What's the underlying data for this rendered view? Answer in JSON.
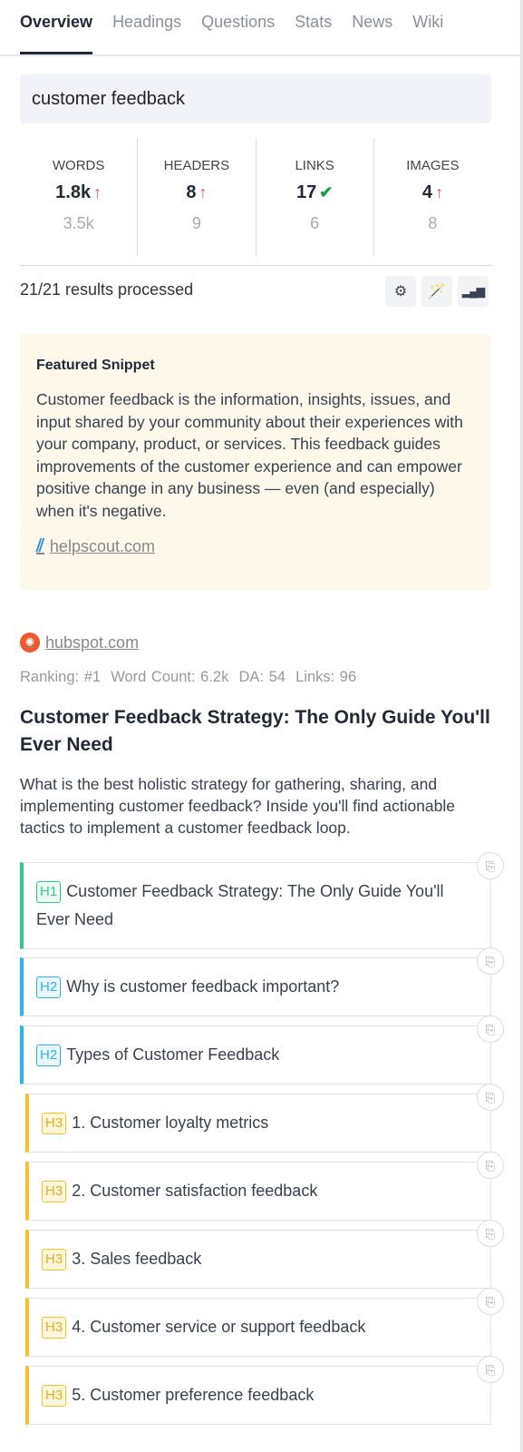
{
  "tabs": [
    "Overview",
    "Headings",
    "Questions",
    "Stats",
    "News",
    "Wiki"
  ],
  "keyword": "customer feedback",
  "stats": [
    {
      "label": "WORDS",
      "value": "1.8k",
      "icon": "arrow-up",
      "color": "#e05a5a",
      "compare": "3.5k"
    },
    {
      "label": "HEADERS",
      "value": "8",
      "icon": "arrow-up",
      "color": "#e05a5a",
      "compare": "9"
    },
    {
      "label": "LINKS",
      "value": "17",
      "icon": "check",
      "color": "#16a34a",
      "compare": "6"
    },
    {
      "label": "IMAGES",
      "value": "4",
      "icon": "arrow-up",
      "color": "#e05a5a",
      "compare": "8"
    }
  ],
  "processed": "21/21 results processed",
  "snippet": {
    "heading": "Featured Snippet",
    "text": "Customer feedback is the information, insights, issues, and input shared by your community about their experiences with your company, product, or services. This feedback guides improvements of the customer experience and can empower positive change in any business — even (and especially) when it's negative.",
    "source": "helpscout.com"
  },
  "result": {
    "source": "hubspot.com",
    "meta": "Ranking: #1  Word Count: 6.2k  DA: 54  Links: 96",
    "title": "Customer Feedback Strategy: The Only Guide You'll Ever Need",
    "description": "What is the best holistic strategy for gathering, sharing, and implementing customer feedback? Inside you'll find actionable tactics to implement a customer feedback loop.",
    "headings": [
      {
        "level": "H1",
        "text": "Customer Feedback Strategy: The Only Guide You'll Ever Need"
      },
      {
        "level": "H2",
        "text": "Why is customer feedback important?"
      },
      {
        "level": "H2",
        "text": "Types of Customer Feedback"
      },
      {
        "level": "H3",
        "text": "1. Customer loyalty metrics"
      },
      {
        "level": "H3",
        "text": "2. Customer satisfaction feedback"
      },
      {
        "level": "H3",
        "text": "3. Sales feedback"
      },
      {
        "level": "H3",
        "text": "4. Customer service or support feedback"
      },
      {
        "level": "H3",
        "text": "5. Customer preference feedback"
      }
    ]
  }
}
